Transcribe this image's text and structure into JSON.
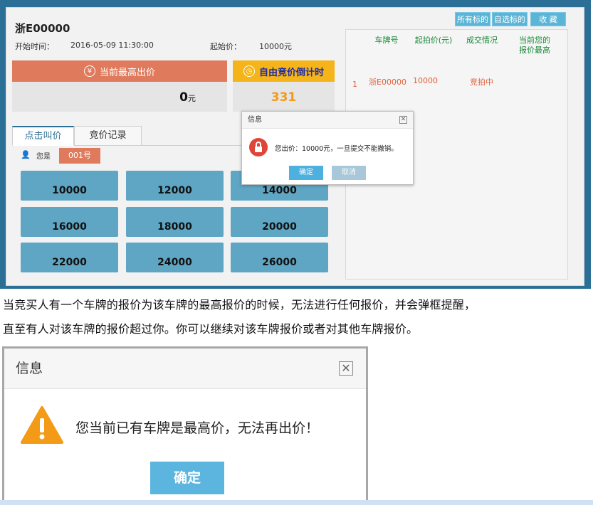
{
  "screenshot": {
    "top_buttons": [
      "所有标的",
      "自选标的",
      "收 藏"
    ],
    "plate": "浙E00000",
    "start_label": "开始时间：",
    "start_value": "2016-05-09 11:30:00",
    "reserve_label": "起始价：",
    "reserve_value": "10000元",
    "highest_label": "当前最高出价",
    "highest_value": "0",
    "highest_unit": "元",
    "countdown_label": "自由竞价倒计时",
    "countdown_value": "331",
    "tabs": [
      "点击叫价",
      "竞价记录"
    ],
    "you_are_label": "您是",
    "bidder_number": "001号",
    "bids": [
      "10000",
      "12000",
      "14000",
      "16000",
      "18000",
      "20000",
      "22000",
      "24000",
      "26000"
    ],
    "table": {
      "headers": [
        "车牌号",
        "起拍价(元)",
        "成交情况",
        "当前您的\n报价最高"
      ],
      "row": {
        "index": "1",
        "plate": "浙E00000",
        "price": "10000",
        "status": "竞拍中"
      }
    },
    "dialog": {
      "title": "信息",
      "message": "您出价：10000元，一旦提交不能撤销。",
      "confirm": "确定",
      "cancel": "取消"
    }
  },
  "caption_line1": "当竞买人有一个车牌的报价为该车牌的最高报价的时候，无法进行任何报价，并会弹框提醒，",
  "caption_line2": "直至有人对该车牌的报价超过你。你可以继续对该车牌报价或者对其他车牌报价。",
  "dialog2": {
    "title": "信息",
    "message": "您当前已有车牌是最高价，无法再出价！",
    "confirm": "确定"
  },
  "colors": {
    "accent_blue": "#5bb5d7",
    "orange": "#df7a5c",
    "yellow": "#f4b41a",
    "bid_button": "#5ea6c4",
    "lock_red": "#e0453a",
    "warning_orange": "#f39a16"
  }
}
